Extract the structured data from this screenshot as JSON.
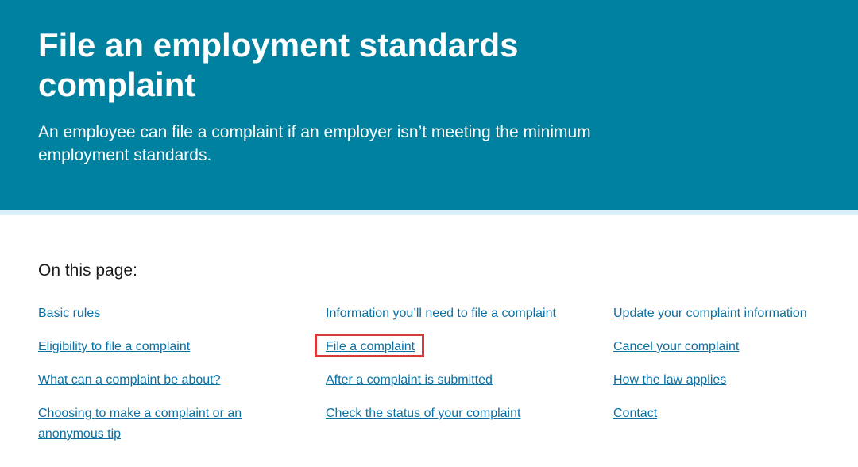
{
  "hero": {
    "title": "File an employment standards complaint",
    "subtitle": "An employee can file a complaint if an employer isn’t meeting the minimum employment standards."
  },
  "toc": {
    "heading": "On this page:",
    "columns": [
      [
        "Basic rules",
        "Eligibility to file a complaint",
        "What can a complaint be about?",
        "Choosing to make a complaint or an anonymous tip"
      ],
      [
        "Information you’ll need to file a complaint",
        "File a complaint",
        "After a complaint is submitted",
        "Check the status of your complaint"
      ],
      [
        "Update your complaint information",
        "Cancel your complaint",
        "How the law applies",
        "Contact"
      ]
    ]
  },
  "colors": {
    "hero_bg": "#00819f",
    "stripe": "#d7f0f7",
    "link": "#0b70a3",
    "highlight_box": "#d63a3a"
  }
}
